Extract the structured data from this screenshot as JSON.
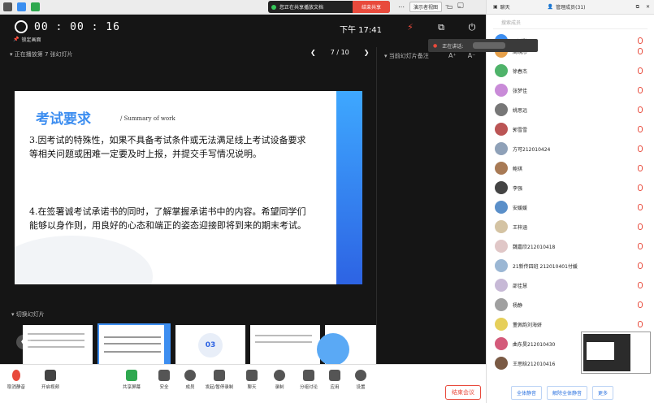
{
  "topbar": {
    "share_status": "您正在共享播放文档",
    "stop_share": "结束共享",
    "menu1": "演示者视图",
    "window_icons": [
      "restore-icon",
      "minimize-icon",
      "grid-icon"
    ]
  },
  "header": {
    "timer": "00 : 00 : 16",
    "pin_label": "锁定画面",
    "time_now": "下午 17:41",
    "speaking_label": "正在讲话:"
  },
  "slide_bar": {
    "title": "正在播放第 7 张幻灯片",
    "page": "7 / 10",
    "notes_title": "当前幻灯片备注",
    "font_up": "A⁺",
    "font_down": "A⁻"
  },
  "slide": {
    "heading": "考试要求",
    "subheading": "/ Summary of work",
    "para1": "3.因考试的特殊性，如果不具备考试条件或无法满足线上考试设备要求等相关问题或困难一定要及时上报，并提交手写情况说明。",
    "para2": "4.在签署诚考试承诺书的同时，了解掌握承诺书中的内容。希望同学们能够以身作则，用良好的心态和端正的姿态迎接即将到来的期末考试。"
  },
  "thumbs": {
    "label": "切换幻灯片",
    "items": [
      {
        "num": "6"
      },
      {
        "num": "7"
      },
      {
        "num": "8",
        "badge": "03"
      },
      {
        "num": "9"
      },
      {
        "num": "10"
      }
    ]
  },
  "bottom": {
    "items": [
      "取消静音",
      "开启视频",
      "共享屏幕",
      "安全",
      "成员",
      "发起/暂停录制",
      "聊天",
      "录制",
      "分组讨论",
      "应用",
      "设置"
    ],
    "end": "结束会议"
  },
  "side": {
    "tab1": "聊天",
    "tab2": "管理成员(31)",
    "search_placeholder": "搜索成员",
    "participants": [
      "王鸿鹏",
      "周晓彤",
      "徐春杰",
      "张梦佳",
      "姚思远",
      "郭雪雪",
      "方可212010424",
      "鲍琪",
      "李强",
      "安媛媛",
      "王梓涵",
      "魏嘉欣212010418",
      "21新传四班 212010401付媛",
      "邵佳慧",
      "杨静",
      "董佩韵刘海妍",
      "曲东昊212010430",
      "王思晗212010416"
    ],
    "footer_btn1": "全体静音",
    "footer_btn2": "解除全体静音",
    "footer_btn3": "更多"
  },
  "colors": {
    "accent": "#3d8ef0",
    "danger": "#e84a3c",
    "dark": "#151515"
  }
}
